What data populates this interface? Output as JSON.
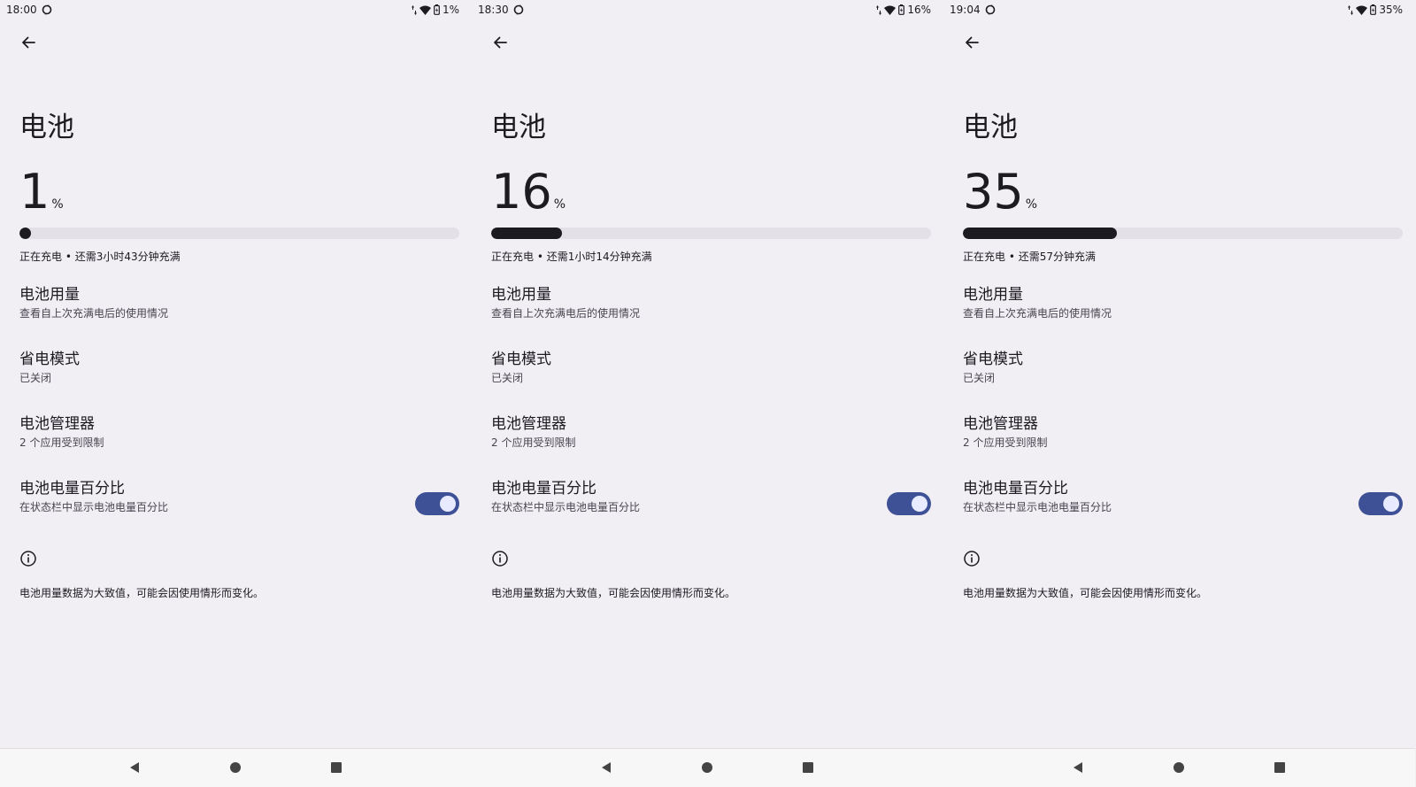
{
  "screens": [
    {
      "time": "18:00",
      "status_battery": "1%",
      "title": "电池",
      "level_number": "1",
      "level_unit": "%",
      "level_fraction": 0.01,
      "charge_status": "正在充电 • 还需3小时43分钟充满",
      "usage": {
        "title": "电池用量",
        "subtitle": "查看自上次充满电后的使用情况"
      },
      "saver": {
        "title": "省电模式",
        "subtitle": "已关闭"
      },
      "manager": {
        "title": "电池管理器",
        "subtitle": "2 个应用受到限制"
      },
      "percentage": {
        "title": "电池电量百分比",
        "subtitle": "在状态栏中显示电池电量百分比",
        "enabled": true
      },
      "footer": "电池用量数据为大致值，可能会因使用情形而变化。"
    },
    {
      "time": "18:30",
      "status_battery": "16%",
      "title": "电池",
      "level_number": "16",
      "level_unit": "%",
      "level_fraction": 0.16,
      "charge_status": "正在充电 • 还需1小时14分钟充满",
      "usage": {
        "title": "电池用量",
        "subtitle": "查看自上次充满电后的使用情况"
      },
      "saver": {
        "title": "省电模式",
        "subtitle": "已关闭"
      },
      "manager": {
        "title": "电池管理器",
        "subtitle": "2 个应用受到限制"
      },
      "percentage": {
        "title": "电池电量百分比",
        "subtitle": "在状态栏中显示电池电量百分比",
        "enabled": true
      },
      "footer": "电池用量数据为大致值，可能会因使用情形而变化。"
    },
    {
      "time": "19:04",
      "status_battery": "35%",
      "title": "电池",
      "level_number": "35",
      "level_unit": "%",
      "level_fraction": 0.35,
      "charge_status": "正在充电 • 还需57分钟充满",
      "usage": {
        "title": "电池用量",
        "subtitle": "查看自上次充满电后的使用情况"
      },
      "saver": {
        "title": "省电模式",
        "subtitle": "已关闭"
      },
      "manager": {
        "title": "电池管理器",
        "subtitle": "2 个应用受到限制"
      },
      "percentage": {
        "title": "电池电量百分比",
        "subtitle": "在状态栏中显示电池电量百分比",
        "enabled": true
      },
      "footer": "电池用量数据为大致值，可能会因使用情形而变化。"
    }
  ],
  "icons": {
    "status_bar": [
      "sync-icon",
      "data-arrows-icon",
      "wifi-icon",
      "battery-charging-icon"
    ],
    "header": "back-arrow-icon",
    "info": "info-icon",
    "nav": [
      "nav-back-icon",
      "nav-home-icon",
      "nav-recents-icon"
    ]
  },
  "colors": {
    "background": "#f1eef4",
    "progress_fill": "#1c1b1f",
    "progress_track": "#e3e0e8",
    "toggle_on": "#3f5196",
    "navbar": "#f7f7f7"
  }
}
